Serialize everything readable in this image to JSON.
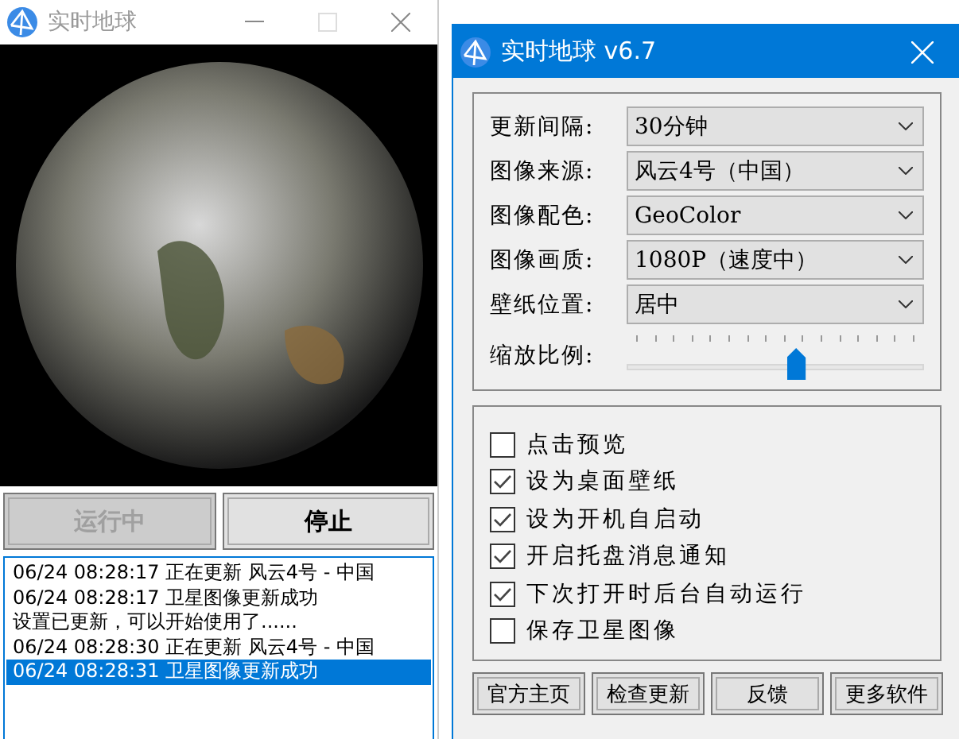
{
  "main_window": {
    "title": "实时地球",
    "active": false,
    "buttons": [
      {
        "label": "运行中",
        "disabled": true
      },
      {
        "label": "停止",
        "disabled": false
      }
    ],
    "log": [
      {
        "text": "06/24 08:28:17 正在更新 风云4号 - 中国",
        "selected": false
      },
      {
        "text": "06/24 08:28:17 卫星图像更新成功",
        "selected": false
      },
      {
        "text": "设置已更新，可以开始使用了......",
        "selected": false
      },
      {
        "text": "06/24 08:28:30 正在更新 风云4号 - 中国",
        "selected": false
      },
      {
        "text": "06/24 08:28:31 卫星图像更新成功",
        "selected": true
      }
    ]
  },
  "settings_window": {
    "title": "实时地球 v6.7",
    "fields": [
      {
        "label": "更新间隔:",
        "value": "30分钟"
      },
      {
        "label": "图像来源:",
        "value": "风云4号（中国）"
      },
      {
        "label": "图像配色:",
        "value": "GeoColor"
      },
      {
        "label": "图像画质:",
        "value": "1080P（速度中）"
      },
      {
        "label": "壁纸位置:",
        "value": "居中"
      }
    ],
    "zoom": {
      "label": "缩放比例:",
      "level": 0.57
    },
    "options": [
      {
        "label": "点击预览",
        "checked": false
      },
      {
        "label": "设为桌面壁纸",
        "checked": true
      },
      {
        "label": "设为开机自启动",
        "checked": true
      },
      {
        "label": "开启托盘消息通知",
        "checked": true
      },
      {
        "label": "下次打开时后台自动运行",
        "checked": true
      },
      {
        "label": "保存卫星图像",
        "checked": false
      }
    ],
    "buttons": [
      "官方主页",
      "检查更新",
      "反馈",
      "更多软件"
    ]
  }
}
